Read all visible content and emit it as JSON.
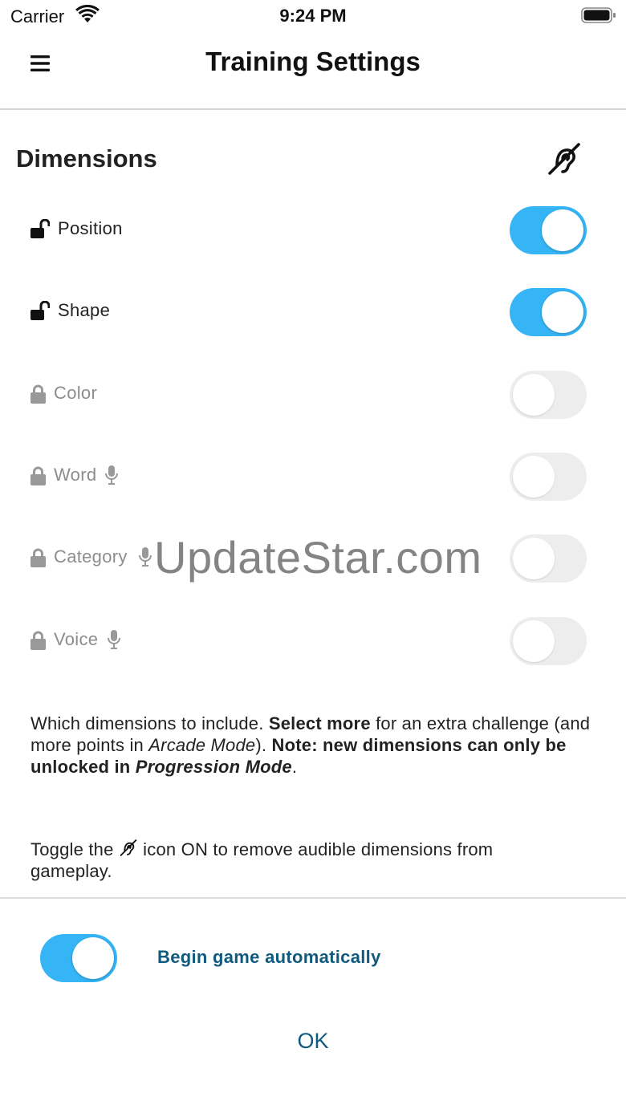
{
  "status_bar": {
    "carrier": "Carrier",
    "time": "9:24 PM"
  },
  "nav": {
    "title": "Training Settings"
  },
  "dimensions": {
    "title": "Dimensions",
    "hearing_toggle_icon": "hearing-impaired-icon",
    "items": [
      {
        "label": "Position",
        "locked": false,
        "audible": false,
        "enabled": true
      },
      {
        "label": "Shape",
        "locked": false,
        "audible": false,
        "enabled": true
      },
      {
        "label": "Color",
        "locked": true,
        "audible": false,
        "enabled": false
      },
      {
        "label": "Word",
        "locked": true,
        "audible": true,
        "enabled": false
      },
      {
        "label": "Category",
        "locked": true,
        "audible": true,
        "enabled": false
      },
      {
        "label": "Voice",
        "locked": true,
        "audible": true,
        "enabled": false
      }
    ]
  },
  "description": {
    "part1": "Which dimensions to include. ",
    "bold1": "Select more",
    "part2": " for an extra challenge (and more points in ",
    "italic1": "Arcade Mode",
    "part3": "). ",
    "bold2": "Note: new dimensions can only be unlocked in ",
    "bold_italic": "Progression Mode",
    "part4": "."
  },
  "hint": {
    "before_icon": "Toggle the ",
    "after_icon": " icon ON to remove audible dimensions from gameplay."
  },
  "auto_begin": {
    "label": "Begin game automatically",
    "enabled": true
  },
  "ok_label": "OK",
  "watermark": "UpdateStar.com",
  "colors": {
    "toggle_on": "#35b5f6",
    "toggle_off": "#ededed",
    "accent_text": "#0f5a7d",
    "locked_text": "#8d8d8d"
  }
}
